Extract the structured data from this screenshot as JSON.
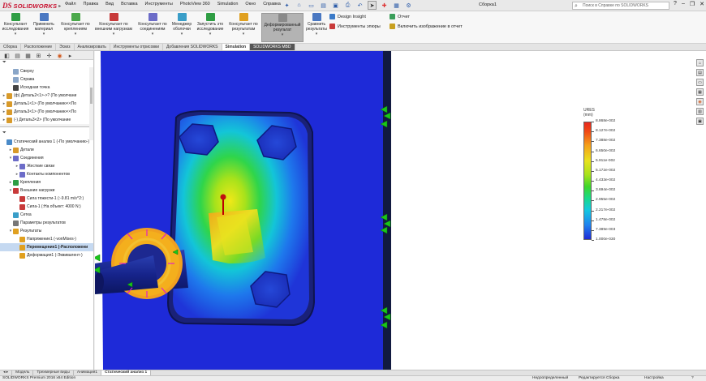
{
  "app": {
    "logo_ds": "DS",
    "logo_text": "SOLIDWORKS",
    "doc_title": "Сборка1",
    "search_placeholder": "Поиск в Справке по SOLIDWORKS"
  },
  "menu": [
    "Файл",
    "Правка",
    "Вид",
    "Вставка",
    "Инструменты",
    "PhotoView 360",
    "Simulation",
    "Окно",
    "Справка"
  ],
  "command_manager": {
    "buttons": [
      {
        "label": "Консультант исследования",
        "color": "#2f9e44"
      },
      {
        "label": "Применить материал",
        "color": "#4a78c2"
      },
      {
        "label": "Консультант по креплениям",
        "color": "#4aa84a"
      },
      {
        "label": "Консультант по внешним нагрузкам",
        "color": "#c83a3a"
      },
      {
        "label": "Консультант по соединениям",
        "color": "#6c6cc8"
      },
      {
        "label": "Менеджер оболочки",
        "color": "#3a9ec8"
      },
      {
        "label": "Запустить это исследование",
        "color": "#2f9e44"
      },
      {
        "label": "Консультант по результатам",
        "color": "#e0a020"
      },
      {
        "label": "Деформированный результат",
        "color": "#8a8a8a"
      },
      {
        "label": "Сравнить результаты",
        "color": "#4a78c2"
      }
    ],
    "right_items": [
      {
        "label": "Design Insight",
        "color": "#3a7ac8"
      },
      {
        "label": "Инструменты эпюры",
        "color": "#c83a3a"
      },
      {
        "label": "Отчет",
        "color": "#3a9e5a"
      },
      {
        "label": "Включить изображение в отчет",
        "color": "#c8a020"
      }
    ]
  },
  "tabs": [
    "Сборка",
    "Расположение",
    "Эскиз",
    "Анализировать",
    "Инструменты отрисовки",
    "Добавления SOLIDWORKS",
    "Simulation",
    "SOLIDWORKS MBD"
  ],
  "feature_tree": [
    {
      "label": "Сверху",
      "indent": 1,
      "twisty": "",
      "color": "#8aa6c8"
    },
    {
      "label": "Справа",
      "indent": 1,
      "twisty": "",
      "color": "#8aa6c8"
    },
    {
      "label": "Исходная точка",
      "indent": 1,
      "twisty": "",
      "color": "#444"
    },
    {
      "label": "(ф) Деталь2<1>->? (По умолчани",
      "indent": 0,
      "twisty": "▸",
      "color": "#d89a2a"
    },
    {
      "label": "Деталь1<1> (По умолчанию<<По",
      "indent": 0,
      "twisty": "▸",
      "color": "#d89a2a"
    },
    {
      "label": "Деталь3<1> (По умолчанию<<По",
      "indent": 0,
      "twisty": "▸",
      "color": "#d89a2a"
    },
    {
      "label": "(-) Деталь3<2> (По умолчание",
      "indent": 0,
      "twisty": "▸",
      "color": "#d89a2a"
    }
  ],
  "sim_tree": [
    {
      "label": "Статический анализ 1 (-По умолчанию-)",
      "indent": 0,
      "twisty": "",
      "color": "#4a8ac8",
      "selected": false
    },
    {
      "label": "Детали",
      "indent": 1,
      "twisty": "▸",
      "color": "#d89a2a",
      "selected": false
    },
    {
      "label": "Соединения",
      "indent": 1,
      "twisty": "▾",
      "color": "#6c6cc8",
      "selected": false
    },
    {
      "label": "Жесткие связи",
      "indent": 2,
      "twisty": "▸",
      "color": "#6c6cc8",
      "selected": false
    },
    {
      "label": "Контакты компонентов",
      "indent": 2,
      "twisty": "▸",
      "color": "#6c6cc8",
      "selected": false
    },
    {
      "label": "Крепления",
      "indent": 1,
      "twisty": "▸",
      "color": "#2f9e44",
      "selected": false
    },
    {
      "label": "Внешние нагрузки",
      "indent": 1,
      "twisty": "▾",
      "color": "#c83a3a",
      "selected": false
    },
    {
      "label": "Сила тяжести-1 (:-9.81 m/s^2:)",
      "indent": 2,
      "twisty": "",
      "color": "#c83a3a",
      "selected": false
    },
    {
      "label": "Сила-1 (:На объект: 4000 N:)",
      "indent": 2,
      "twisty": "",
      "color": "#c83a3a",
      "selected": false
    },
    {
      "label": "Сетка",
      "indent": 1,
      "twisty": "",
      "color": "#3a9ec8",
      "selected": false
    },
    {
      "label": "Параметры результатов",
      "indent": 1,
      "twisty": "",
      "color": "#777",
      "selected": false
    },
    {
      "label": "Результаты",
      "indent": 1,
      "twisty": "▾",
      "color": "#e0a020",
      "selected": false
    },
    {
      "label": "Напряжение1 (-vonMises-)",
      "indent": 2,
      "twisty": "",
      "color": "#e0a020",
      "selected": false
    },
    {
      "label": "Перемещение1 (-Расположени",
      "indent": 2,
      "twisty": "",
      "color": "#e0a020",
      "selected": true
    },
    {
      "label": "Деформация1 (-Эквивалент-)",
      "indent": 2,
      "twisty": "",
      "color": "#e0a020",
      "selected": false
    }
  ],
  "legend": {
    "title": "URES (mm)",
    "labels": [
      "8.868e-002",
      "8.127e-002",
      "7.388e-002",
      "6.650e-002",
      "5.911e-002",
      "5.172e-002",
      "4.433e-002",
      "3.694e-002",
      "2.955e-002",
      "2.217e-002",
      "1.478e-002",
      "7.389e-003",
      "1.000e-030"
    ]
  },
  "bottom_tabs": [
    "Модель",
    "Трехмерные виды",
    "Анимация1",
    "Статический анализ 1"
  ],
  "bottom_active": 3,
  "status": {
    "edition": "SOLIDWORKS Premium 2016 x64 Edition",
    "constraint": "Недоопределенный",
    "mode": "Редактируется Сборка",
    "settings": "Настройка"
  }
}
